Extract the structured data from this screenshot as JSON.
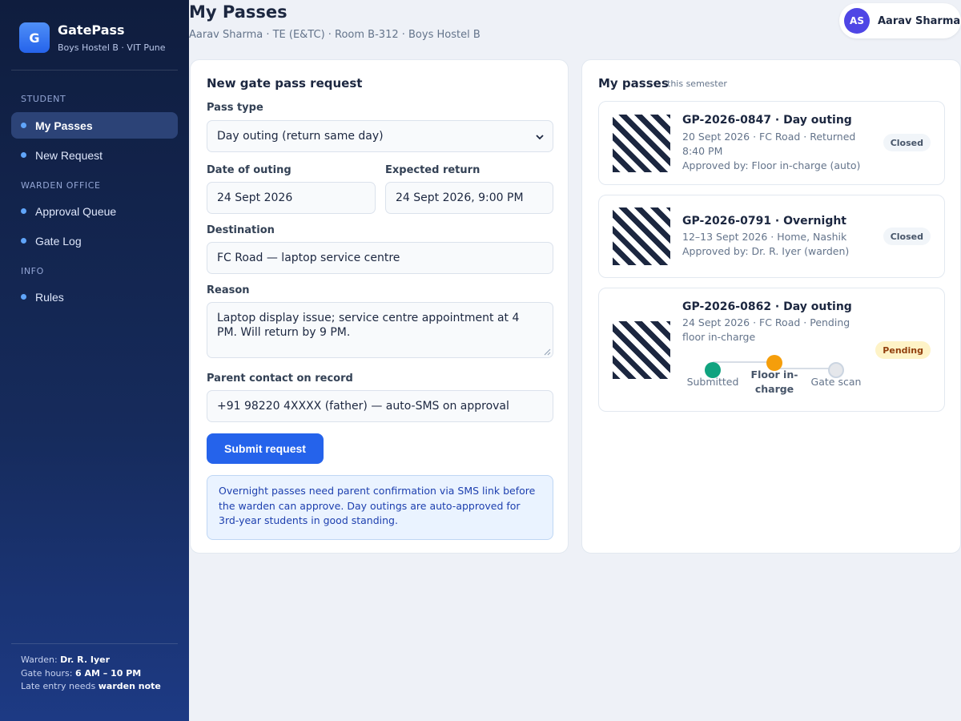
{
  "app": {
    "name": "GatePass",
    "subtitle": "Boys Hostel B · VIT Pune",
    "logo_letter": "G"
  },
  "sidebar": {
    "sections": [
      {
        "title": "STUDENT",
        "items": [
          {
            "label": "My Passes",
            "active": true
          },
          {
            "label": "New Request"
          }
        ]
      },
      {
        "title": "WARDEN OFFICE",
        "items": [
          {
            "label": "Approval Queue"
          },
          {
            "label": "Gate Log"
          }
        ]
      },
      {
        "title": "INFO",
        "items": [
          {
            "label": "Rules"
          }
        ]
      }
    ],
    "footer": {
      "warden_label": "Warden:",
      "warden_value": "Dr. R. Iyer",
      "hours_label": "Gate hours:",
      "hours_value": "6 AM – 10 PM",
      "late_label": "Late entry needs",
      "late_value": "warden note"
    }
  },
  "header": {
    "title": "My Passes",
    "subtitle": "Aarav Sharma · TE (E&TC) · Room B-312 · Boys Hostel B",
    "user": {
      "initials": "AS",
      "name": "Aarav Sharma"
    }
  },
  "form": {
    "title": "New gate pass request",
    "pass_type": {
      "label": "Pass type",
      "value": "Day outing (return same day)"
    },
    "date": {
      "label": "Date of outing",
      "value": "24 Sept 2026"
    },
    "expected_return": {
      "label": "Expected return",
      "value": "24 Sept 2026, 9:00 PM"
    },
    "destination": {
      "label": "Destination",
      "value": "FC Road — laptop service centre"
    },
    "reason": {
      "label": "Reason",
      "value": "Laptop display issue; service centre appointment at 4 PM. Will return by 9 PM."
    },
    "parent_contact": {
      "label": "Parent contact on record",
      "value": "+91 98220 4XXXX (father) — auto-SMS on approval"
    },
    "submit_label": "Submit request",
    "info_text": "Overnight passes need parent confirmation via SMS link before the warden can approve. Day outings are auto-approved for 3rd-year students in good standing."
  },
  "passes": {
    "title": "My passes",
    "meta": "this semester",
    "items": [
      {
        "id": "GP-2026-0847 · Day outing",
        "details": "20 Sept 2026 · FC Road · Returned 8:40 PM",
        "approval": "Approved by: Floor in-charge (auto)",
        "status": "Closed"
      },
      {
        "id": "GP-2026-0791 · Overnight",
        "details": "12–13 Sept 2026 · Home, Nashik",
        "approval": "Approved by: Dr. R. Iyer (warden)",
        "status": "Closed"
      },
      {
        "id": "GP-2026-0862 · Day outing",
        "details": "24 Sept 2026 · FC Road · Pending floor in-charge",
        "status": "Pending",
        "tracker": {
          "steps": [
            "Submitted",
            "Floor in-charge",
            "Gate scan"
          ],
          "current": "Floor in-charge"
        }
      }
    ]
  },
  "colors": {
    "accent": "#2563eb",
    "sidebar": "#0f1d3e",
    "step_done": "#10a37f",
    "step_current": "#f59e0b",
    "step_todo": "#e2e8f0"
  }
}
